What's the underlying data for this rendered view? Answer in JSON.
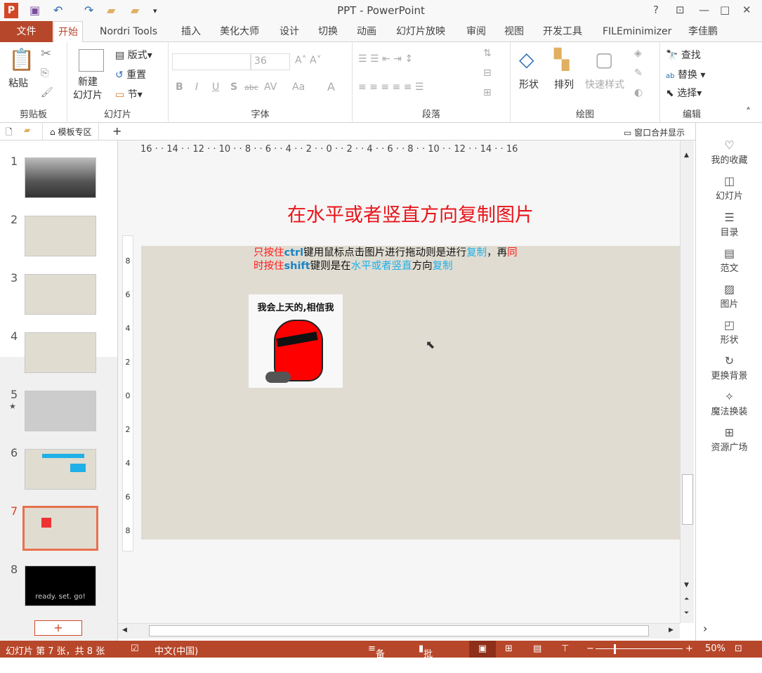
{
  "window": {
    "title": "PPT - PowerPoint",
    "help": "?",
    "controls": [
      "restore-ribbon",
      "minimize",
      "maximize",
      "close"
    ]
  },
  "tabs": [
    "文件",
    "开始",
    "Nordri Tools",
    "插入",
    "美化大师",
    "设计",
    "切换",
    "动画",
    "幻灯片放映",
    "审阅",
    "视图",
    "开发工具",
    "FILEminimizer"
  ],
  "user": "李佳鹏",
  "ribbon": {
    "clipboard": {
      "label": "剪贴板",
      "paste": "粘贴"
    },
    "slides": {
      "label": "幻灯片",
      "new_slide": "新建\n幻灯片",
      "layout": "版式",
      "reset": "重置",
      "section": "节"
    },
    "font": {
      "label": "字体",
      "font_name": "",
      "font_size": "36",
      "bold": "B",
      "italic": "I",
      "underline": "U",
      "shadow": "S",
      "strike": "abc",
      "spacing": "AV",
      "case": "Aa",
      "color": "A"
    },
    "paragraph": {
      "label": "段落"
    },
    "drawing": {
      "label": "绘图",
      "shapes": "形状",
      "arrange": "排列",
      "quick_styles": "快速样式"
    },
    "editing": {
      "label": "编辑",
      "find": "查找",
      "replace": "替换",
      "select": "选择"
    }
  },
  "secbar": {
    "template_zone": "模板专区",
    "add": "+",
    "merge_windows": "窗口合并显示"
  },
  "thumbnails": [
    {
      "n": "1"
    },
    {
      "n": "2"
    },
    {
      "n": "3"
    },
    {
      "n": "4"
    },
    {
      "n": "5",
      "star": "★"
    },
    {
      "n": "6"
    },
    {
      "n": "7",
      "selected": true
    },
    {
      "n": "8",
      "caption": "ready. set. go!"
    }
  ],
  "add_slide": "+",
  "ruler": {
    "h": "16 · · 14 · · 12 · · 10 · · 8 · · 6 · · 4 · · 2 · · 0 · · 2 · · 4 · · 6 · · 8 · · 10 · · 12 · · 14 · · 16",
    "v": [
      "8",
      "6",
      "4",
      "2",
      "0",
      "2",
      "4",
      "6",
      "8"
    ]
  },
  "slide": {
    "title": "在水平或者竖直方向复制图片",
    "body": [
      {
        "t": "只按住",
        "c": "red"
      },
      {
        "t": "ctrl",
        "c": "bold"
      },
      {
        "t": "键用鼠标点击图片进行拖动则是进行",
        "c": ""
      },
      {
        "t": "复制",
        "c": "blue"
      },
      {
        "t": "，再",
        "c": ""
      },
      {
        "t": "同时按住",
        "c": "red"
      },
      {
        "t": "shift",
        "c": "bold"
      },
      {
        "t": "键则是在",
        "c": ""
      },
      {
        "t": "水平或者竖直",
        "c": "blue"
      },
      {
        "t": "方向",
        "c": ""
      },
      {
        "t": "复制",
        "c": "blue"
      }
    ],
    "image_caption": "我会上天的,相信我"
  },
  "right_panel": [
    "我的收藏",
    "幻灯片",
    "目录",
    "范文",
    "图片",
    "形状",
    "更换背景",
    "魔法换装",
    "资源广场"
  ],
  "status": {
    "slide_info": "幻灯片 第 7 张，共 8 张",
    "language": "中文(中国)",
    "notes": "备注",
    "comments": "批注",
    "zoom": "50%",
    "zoom_fraction": 0.5
  },
  "colors": {
    "accent": "#b7472a",
    "slide_bg": "#e0dcd1",
    "title_red": "#e8151b"
  }
}
